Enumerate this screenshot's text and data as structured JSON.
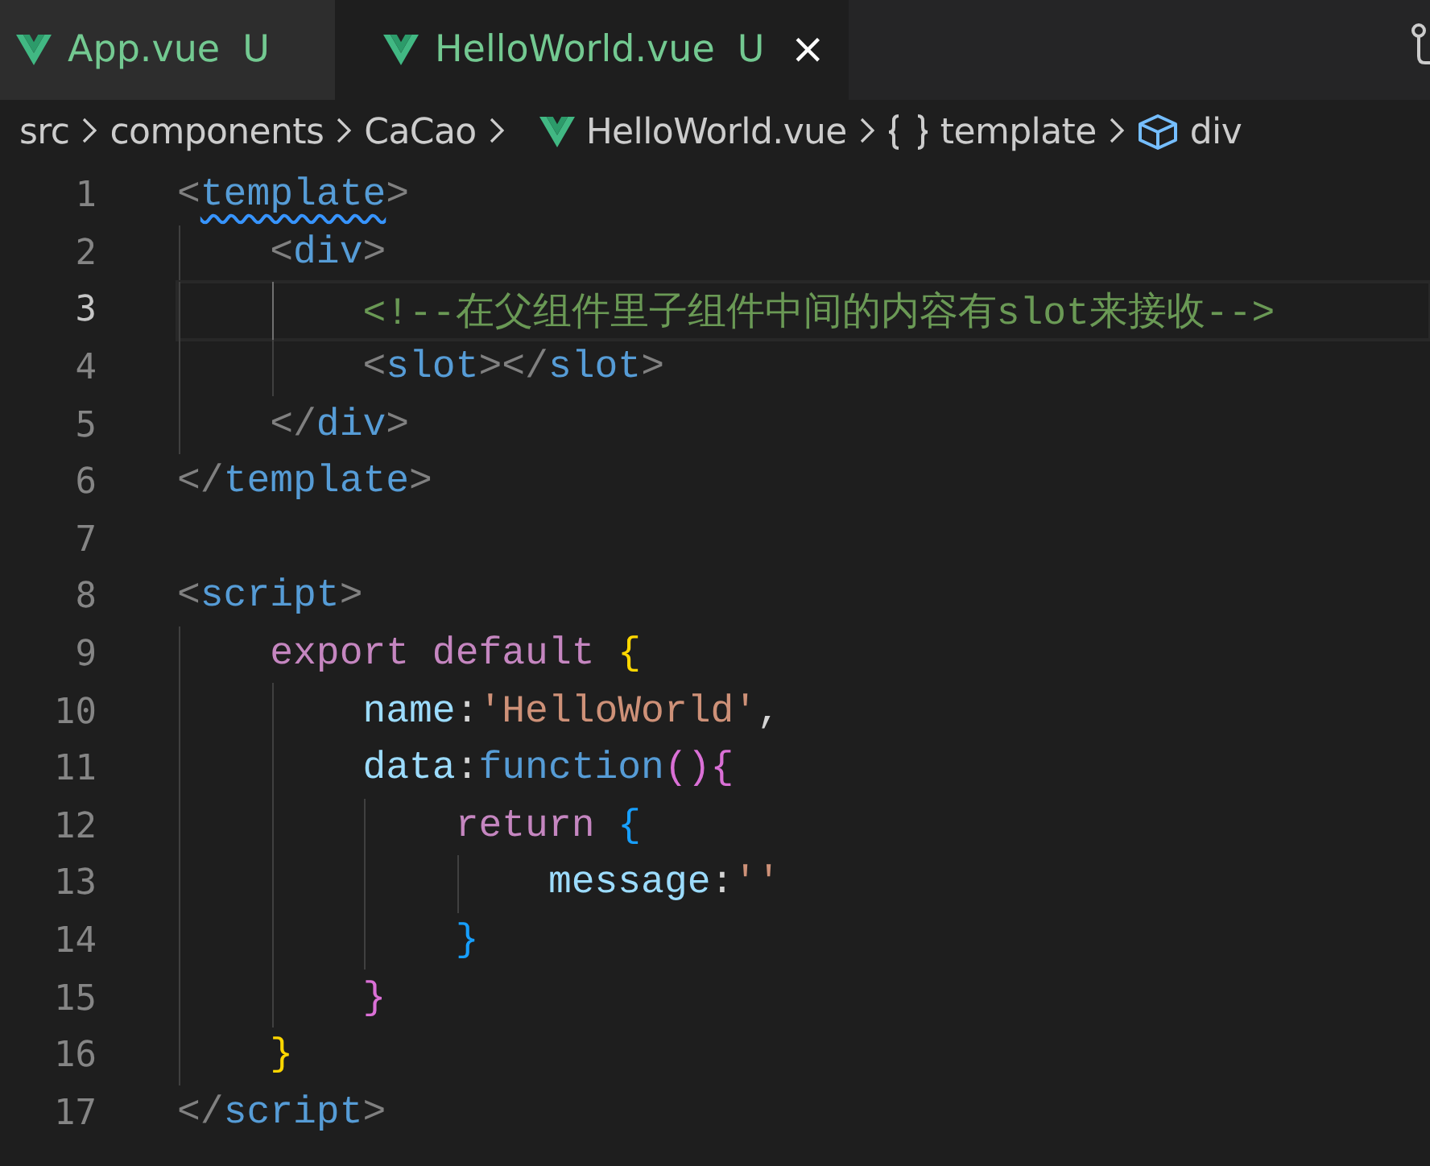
{
  "tabs": [
    {
      "label": "App.vue",
      "status": "U",
      "selected": false
    },
    {
      "label": "HelloWorld.vue",
      "status": "U",
      "selected": true,
      "close": "×"
    }
  ],
  "breadcrumb": [
    {
      "label": "src",
      "kind": "folder"
    },
    {
      "label": "components",
      "kind": "folder"
    },
    {
      "label": "CaCao",
      "kind": "folder"
    },
    {
      "label": "HelloWorld.vue",
      "kind": "vue-file"
    },
    {
      "label": "template",
      "kind": "braces"
    },
    {
      "label": "div",
      "kind": "element"
    }
  ],
  "lines": [
    {
      "number": "1",
      "current": false,
      "tokens": [
        {
          "text": "<",
          "kind": "punct"
        },
        {
          "text": "template",
          "kind": "tag",
          "squiggle": true
        },
        {
          "text": ">",
          "kind": "punct"
        }
      ]
    },
    {
      "number": "2",
      "current": false,
      "tokens": [
        {
          "text": "    <",
          "kind": "punct"
        },
        {
          "text": "div",
          "kind": "tag"
        },
        {
          "text": ">",
          "kind": "punct"
        }
      ]
    },
    {
      "number": "3",
      "current": true,
      "tokens": [
        {
          "text": "        <!--在父组件里子组件中间的内容有slot来接收-->",
          "kind": "comment"
        }
      ]
    },
    {
      "number": "4",
      "current": false,
      "tokens": [
        {
          "text": "        <",
          "kind": "punct"
        },
        {
          "text": "slot",
          "kind": "tag"
        },
        {
          "text": "></",
          "kind": "punct"
        },
        {
          "text": "slot",
          "kind": "tag"
        },
        {
          "text": ">",
          "kind": "punct"
        }
      ]
    },
    {
      "number": "5",
      "current": false,
      "tokens": [
        {
          "text": "    </",
          "kind": "punct"
        },
        {
          "text": "div",
          "kind": "tag"
        },
        {
          "text": ">",
          "kind": "punct"
        }
      ]
    },
    {
      "number": "6",
      "current": false,
      "tokens": [
        {
          "text": "</",
          "kind": "punct"
        },
        {
          "text": "template",
          "kind": "tag"
        },
        {
          "text": ">",
          "kind": "punct"
        }
      ]
    },
    {
      "number": "7",
      "current": false
    },
    {
      "number": "8",
      "current": false,
      "tokens": [
        {
          "text": "<",
          "kind": "punct"
        },
        {
          "text": "script",
          "kind": "tag"
        },
        {
          "text": ">",
          "kind": "punct"
        }
      ]
    },
    {
      "number": "9",
      "current": false,
      "tokens": [
        {
          "text": "    export default ",
          "kind": "keyword"
        },
        {
          "text": "{",
          "kind": "brace1"
        }
      ]
    },
    {
      "number": "10",
      "current": false,
      "tokens": [
        {
          "text": "        name",
          "kind": "property"
        },
        {
          "text": ":",
          "kind": "text"
        },
        {
          "text": "'HelloWorld'",
          "kind": "string"
        },
        {
          "text": ",",
          "kind": "text"
        }
      ]
    },
    {
      "number": "11",
      "current": false,
      "tokens": [
        {
          "text": "        data",
          "kind": "property"
        },
        {
          "text": ":",
          "kind": "text"
        },
        {
          "text": "function",
          "kind": "storage"
        },
        {
          "text": "()",
          "kind": "brace2"
        },
        {
          "text": "{",
          "kind": "brace2"
        }
      ]
    },
    {
      "number": "12",
      "current": false,
      "tokens": [
        {
          "text": "            return ",
          "kind": "keyword"
        },
        {
          "text": "{",
          "kind": "brace3"
        }
      ]
    },
    {
      "number": "13",
      "current": false,
      "tokens": [
        {
          "text": "                message",
          "kind": "property"
        },
        {
          "text": ":",
          "kind": "text"
        },
        {
          "text": "''",
          "kind": "string"
        }
      ]
    },
    {
      "number": "14",
      "current": false,
      "tokens": [
        {
          "text": "            }",
          "kind": "brace3"
        }
      ]
    },
    {
      "number": "15",
      "current": false,
      "tokens": [
        {
          "text": "        }",
          "kind": "brace2"
        }
      ]
    },
    {
      "number": "16",
      "current": false,
      "tokens": [
        {
          "text": "    }",
          "kind": "brace1"
        }
      ]
    },
    {
      "number": "17",
      "current": false,
      "tokens": [
        {
          "text": "</",
          "kind": "punct"
        },
        {
          "text": "script",
          "kind": "tag"
        },
        {
          "text": ">",
          "kind": "punct"
        }
      ]
    }
  ]
}
